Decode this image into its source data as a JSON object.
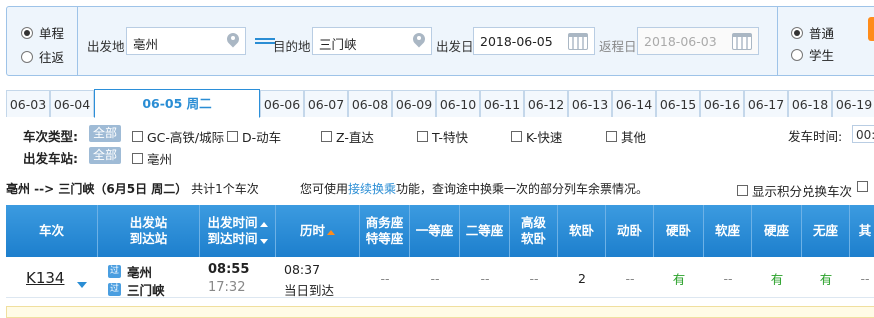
{
  "search": {
    "trip_types": [
      {
        "label": "单程",
        "checked": true
      },
      {
        "label": "往返",
        "checked": false
      }
    ],
    "from_label": "出发地",
    "from_value": "亳州",
    "to_label": "目的地",
    "to_value": "三门峡",
    "depart_label": "出发日",
    "depart_value": "2018-06-05",
    "return_label": "返程日",
    "return_value": "2018-06-03",
    "passenger_types": [
      {
        "label": "普通",
        "checked": true
      },
      {
        "label": "学生",
        "checked": false
      }
    ]
  },
  "date_tabs": [
    {
      "label": "06-03",
      "active": false
    },
    {
      "label": "06-04",
      "active": false
    },
    {
      "label": "06-05 周二",
      "active": true
    },
    {
      "label": "06-06",
      "active": false
    },
    {
      "label": "06-07",
      "active": false
    },
    {
      "label": "06-08",
      "active": false
    },
    {
      "label": "06-09",
      "active": false
    },
    {
      "label": "06-10",
      "active": false
    },
    {
      "label": "06-11",
      "active": false
    },
    {
      "label": "06-12",
      "active": false
    },
    {
      "label": "06-13",
      "active": false
    },
    {
      "label": "06-14",
      "active": false
    },
    {
      "label": "06-15",
      "active": false
    },
    {
      "label": "06-16",
      "active": false
    },
    {
      "label": "06-17",
      "active": false
    },
    {
      "label": "06-18",
      "active": false
    },
    {
      "label": "06-19",
      "active": false
    }
  ],
  "filters": {
    "train_type_label": "车次类型:",
    "all_label": "全部",
    "train_types": [
      "GC-高铁/城际",
      "D-动车",
      "Z-直达",
      "T-特快",
      "K-快速",
      "其他"
    ],
    "depart_time_label": "发车时间:",
    "depart_time_value": "00:",
    "depart_station_label": "出发车站:",
    "depart_stations": [
      "亳州"
    ]
  },
  "summary": {
    "route": "亳州 --> 三门峡（6月5日  周二）",
    "count_text": "共计1个车次",
    "tip_prefix": "您可使用",
    "tip_link": "接续换乘",
    "tip_suffix": "功能，查询途中换乘一次的部分列车余票情况。",
    "show_points_label": "显示积分兑换车次"
  },
  "table": {
    "headers": {
      "train": "车次",
      "station_1": "出发站",
      "station_2": "到达站",
      "time_1": "出发时间",
      "time_2": "到达时间",
      "duration": "历时",
      "business_1": "商务座",
      "business_2": "特等座",
      "first": "一等座",
      "second": "二等座",
      "premium_1": "高级",
      "premium_2": "软卧",
      "soft_sleeper": "软卧",
      "emu_sleeper": "动卧",
      "hard_sleeper": "硬卧",
      "soft_seat": "软座",
      "hard_seat": "硬座",
      "no_seat": "无座",
      "other": "其"
    },
    "rows": [
      {
        "train_no": "K134",
        "from_badge": "过",
        "from_station": "亳州",
        "to_badge": "过",
        "to_station": "三门峡",
        "depart_time": "08:55",
        "arrive_time": "17:32",
        "duration": "08:37",
        "arrive_day": "当日到达",
        "business": "--",
        "first": "--",
        "second": "--",
        "premium_sleeper": "--",
        "soft_sleeper": "2",
        "emu_sleeper": "--",
        "hard_sleeper": "有",
        "soft_seat": "--",
        "hard_seat": "有",
        "no_seat": "有",
        "other": "--"
      }
    ]
  }
}
